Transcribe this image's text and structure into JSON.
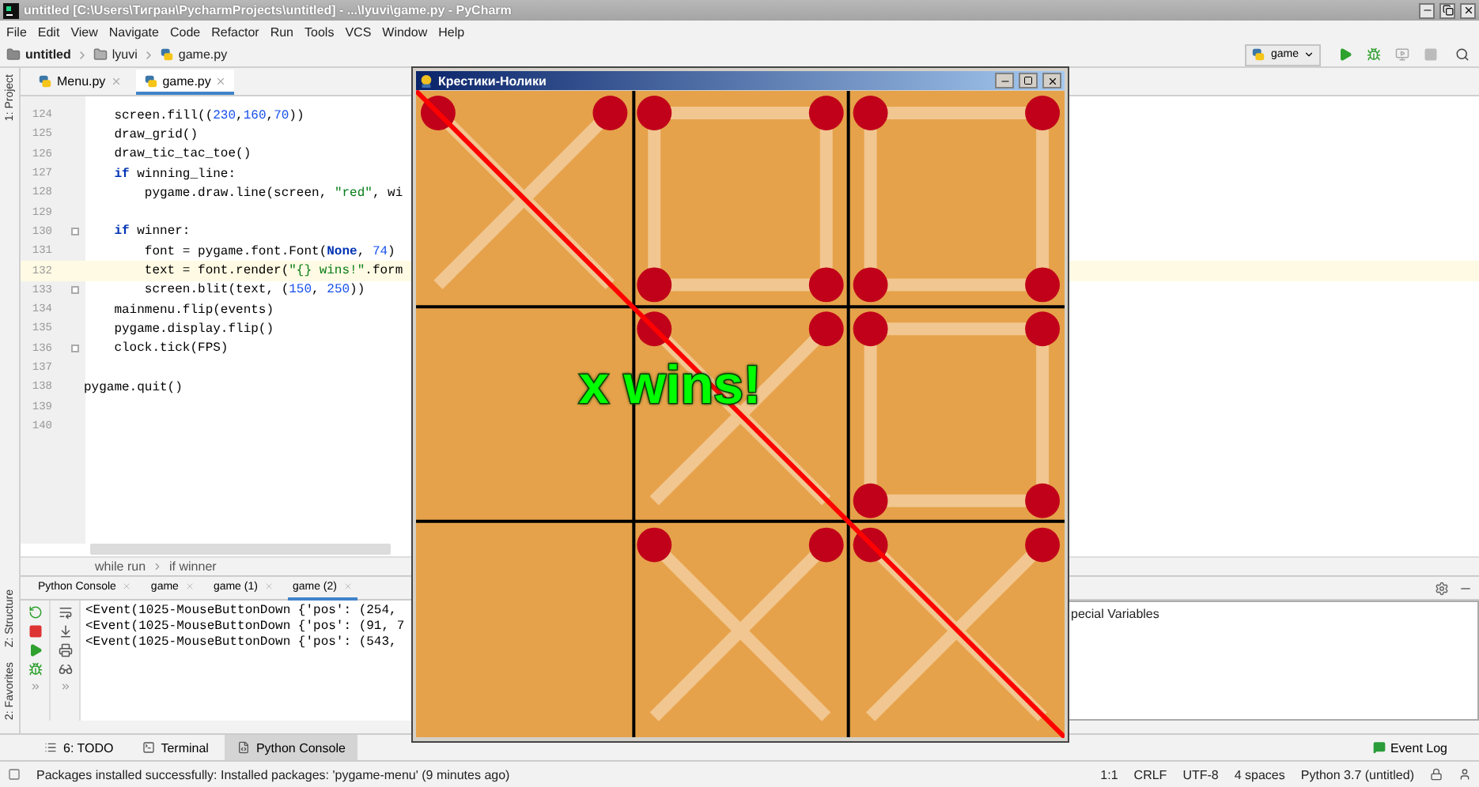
{
  "window": {
    "title": "untitled [C:\\Users\\Тигран\\PycharmProjects\\untitled] - ...\\lyuvi\\game.py - PyCharm"
  },
  "menu": [
    "File",
    "Edit",
    "View",
    "Navigate",
    "Code",
    "Refactor",
    "Run",
    "Tools",
    "VCS",
    "Window",
    "Help"
  ],
  "breadcrumb": [
    {
      "label": "untitled",
      "kind": "project"
    },
    {
      "label": "lyuvi",
      "kind": "folder"
    },
    {
      "label": "game.py",
      "kind": "file"
    }
  ],
  "run_config": {
    "label": "game"
  },
  "side_tools": [
    "1: Project",
    "Z: Structure",
    "2: Favorites"
  ],
  "editor_tabs": [
    {
      "label": "Menu.py",
      "selected": false
    },
    {
      "label": "game.py",
      "selected": true
    }
  ],
  "code_lines": [
    {
      "number": "124",
      "segments": [
        {
          "kind": "plain",
          "text": "    screen.fill(("
        },
        {
          "kind": "num",
          "text": "230"
        },
        {
          "kind": "plain",
          "text": ","
        },
        {
          "kind": "num",
          "text": "160"
        },
        {
          "kind": "plain",
          "text": ","
        },
        {
          "kind": "num",
          "text": "70"
        },
        {
          "kind": "plain",
          "text": "))"
        }
      ]
    },
    {
      "number": "125",
      "segments": [
        {
          "kind": "plain",
          "text": "    draw_grid()"
        }
      ]
    },
    {
      "number": "126",
      "segments": [
        {
          "kind": "plain",
          "text": "    draw_tic_tac_toe()"
        }
      ]
    },
    {
      "number": "127",
      "segments": [
        {
          "kind": "kw",
          "text": "    if"
        },
        {
          "kind": "plain",
          "text": " winning_line:"
        }
      ]
    },
    {
      "number": "128",
      "segments": [
        {
          "kind": "plain",
          "text": "        pygame.draw.line(screen, "
        },
        {
          "kind": "str",
          "text": "\"red\""
        },
        {
          "kind": "plain",
          "text": ", wi"
        }
      ]
    },
    {
      "number": "129"
    },
    {
      "number": "130",
      "fold": true,
      "segments": [
        {
          "kind": "kw",
          "text": "    if"
        },
        {
          "kind": "plain",
          "text": " winner:"
        }
      ]
    },
    {
      "number": "131",
      "segments": [
        {
          "kind": "plain",
          "text": "        font = pygame.font.Font("
        },
        {
          "kind": "kw",
          "text": "None"
        },
        {
          "kind": "plain",
          "text": ", "
        },
        {
          "kind": "num",
          "text": "74"
        },
        {
          "kind": "plain",
          "text": ")"
        }
      ]
    },
    {
      "number": "132",
      "current": true,
      "segments": [
        {
          "kind": "plain",
          "text": "        text = font.render("
        },
        {
          "kind": "str",
          "text": "\"{} wins!\""
        },
        {
          "kind": "plain",
          "text": ".form"
        }
      ]
    },
    {
      "number": "133",
      "fold": true,
      "segments": [
        {
          "kind": "plain",
          "text": "        screen.blit(text, ("
        },
        {
          "kind": "num",
          "text": "150"
        },
        {
          "kind": "plain",
          "text": ", "
        },
        {
          "kind": "num",
          "text": "250"
        },
        {
          "kind": "plain",
          "text": "))"
        }
      ]
    },
    {
      "number": "134",
      "segments": [
        {
          "kind": "plain",
          "text": "    mainmenu.flip(events)"
        }
      ]
    },
    {
      "number": "135",
      "segments": [
        {
          "kind": "plain",
          "text": "    pygame.display.flip()"
        }
      ]
    },
    {
      "number": "136",
      "fold": true,
      "segments": [
        {
          "kind": "plain",
          "text": "    clock.tick(FPS)"
        }
      ]
    },
    {
      "number": "137"
    },
    {
      "number": "138",
      "segments": [
        {
          "kind": "plain",
          "text": "pygame.quit()"
        }
      ]
    },
    {
      "number": "139"
    },
    {
      "number": "140"
    }
  ],
  "editor_breadcrumb": [
    "while run",
    "if winner"
  ],
  "console_tabs": [
    {
      "label": "Python Console",
      "selected": false
    },
    {
      "label": "game",
      "selected": false
    },
    {
      "label": "game (1)",
      "selected": false
    },
    {
      "label": "game (2)",
      "selected": true
    }
  ],
  "console_lines": [
    "<Event(1025-MouseButtonDown {'pos': (254,",
    "<Event(1025-MouseButtonDown {'pos': (91, 7",
    "<Event(1025-MouseButtonDown {'pos': (543,"
  ],
  "variables_label": "pecial Variables",
  "tool_tabs": [
    {
      "label": "6: TODO",
      "kind": "todo",
      "selected": false
    },
    {
      "label": "Terminal",
      "kind": "terminal",
      "selected": false
    },
    {
      "label": "Python Console",
      "kind": "console",
      "selected": true
    }
  ],
  "event_log": "Event Log",
  "status_message": "Packages installed successfully: Installed packages: 'pygame-menu' (9 minutes ago)",
  "status_items": [
    "1:1",
    "CRLF",
    "UTF-8",
    "4 spaces",
    "Python 3.7 (untitled)"
  ],
  "game_window": {
    "title": "Крестики-Нолики",
    "winner_text": "x wins!",
    "winning_line": true,
    "cells": [
      {
        "kind": "x"
      },
      {
        "kind": "o"
      },
      {
        "kind": "o"
      },
      {
        "kind": "empty"
      },
      {
        "kind": "x"
      },
      {
        "kind": "o"
      },
      {
        "kind": "empty"
      },
      {
        "kind": "x"
      },
      {
        "kind": "x"
      }
    ]
  }
}
